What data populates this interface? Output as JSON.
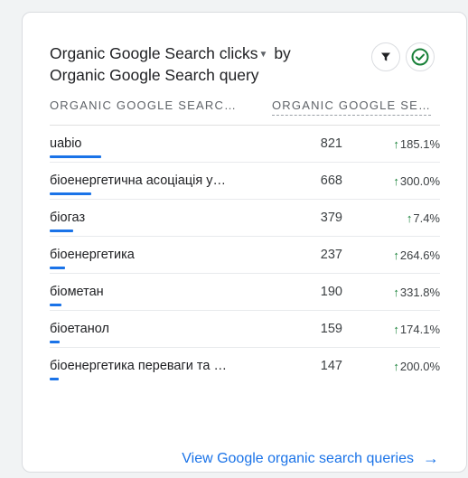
{
  "card": {
    "title_part1": "Organic Google Search clicks",
    "title_part2": "by",
    "title_line2": "Organic Google Search query",
    "filter_icon": "filter-icon",
    "check_icon": "check-circle-icon"
  },
  "columns": {
    "query": "ORGANIC GOOGLE SEARC…",
    "clicks": "ORGANIC GOOGLE SE…"
  },
  "rows": [
    {
      "query": "uabio",
      "clicks": "821",
      "change": "185.1%",
      "share": 1.0
    },
    {
      "query": "біоенергетична асоціація у…",
      "clicks": "668",
      "change": "300.0%",
      "share": 0.81
    },
    {
      "query": "біогаз",
      "clicks": "379",
      "change": "7.4%",
      "share": 0.46
    },
    {
      "query": "біоенергетика",
      "clicks": "237",
      "change": "264.6%",
      "share": 0.29
    },
    {
      "query": "біометан",
      "clicks": "190",
      "change": "331.8%",
      "share": 0.23
    },
    {
      "query": "біоетанол",
      "clicks": "159",
      "change": "174.1%",
      "share": 0.19
    },
    {
      "query": "біоенергетика переваги та …",
      "clicks": "147",
      "change": "200.0%",
      "share": 0.18
    }
  ],
  "footer": {
    "link": "View Google organic search queries",
    "arrow_icon": "arrow-right-icon"
  },
  "colors": {
    "accent": "#1a73e8",
    "positive": "#188038",
    "check": "#188038"
  }
}
